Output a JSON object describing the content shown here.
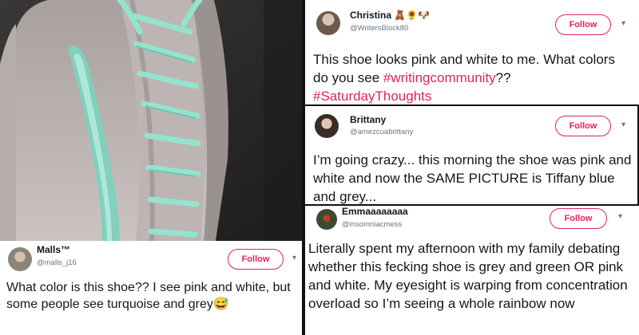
{
  "photo": {
    "alt_icon": "shoe-photo"
  },
  "tweets": [
    {
      "name": "Christina",
      "name_emoji": "🧸🌻🐶",
      "handle": "@WritersBlock80",
      "follow_label": "Follow",
      "text_plain": "This shoe looks pink and white to me. What colors do you see ",
      "hashtag1": "#writingcommunity",
      "text_after": "??",
      "hashtag2": "#SaturdayThoughts"
    },
    {
      "name": "Brittany",
      "handle": "@amezcuabrittany",
      "follow_label": "Follow",
      "text": "I’m going crazy... this morning the shoe was pink and white and now the SAME PICTURE is Tiffany blue and grey..."
    },
    {
      "name": "Emmaaaaaaaa",
      "handle": "@insomniacmess",
      "follow_label": "Follow",
      "text": "Literally spent my afternoon with my family debating whether this fecking shoe is grey and green OR pink and white. My eyesight is warping from concentration overload so I’m seeing a whole rainbow now"
    },
    {
      "name": "Malls™",
      "handle": "@malls_j16",
      "follow_label": "Follow",
      "text": "What color is this shoe?? I see pink and white, but some people see turquoise and grey",
      "emoji": "😅"
    }
  ],
  "colors": {
    "follow": "#e0245e",
    "hashtag": "#e0245e",
    "shoe": "#c4bdbb",
    "lace": "#8fe0c9"
  }
}
